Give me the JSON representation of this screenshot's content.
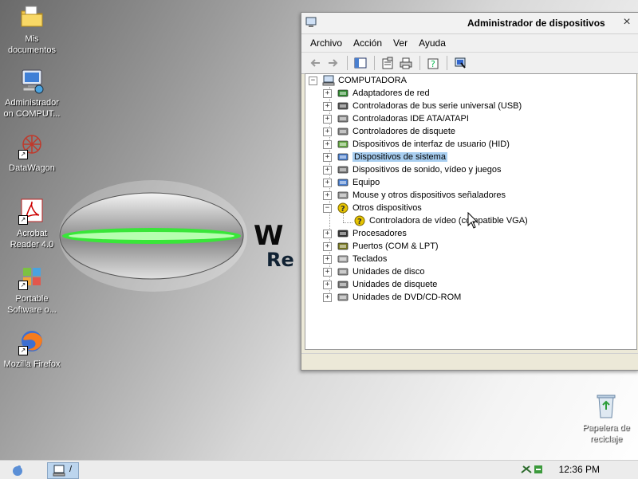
{
  "desktop": {
    "icons": [
      {
        "label_line1": "Mis",
        "label_line2": "documentos",
        "icon": "folder-documents-icon"
      },
      {
        "label_line1": "Administrador",
        "label_line2": "on COMPUT...",
        "icon": "computer-icon"
      },
      {
        "label_line1": "DataWagon",
        "label_line2": "",
        "icon": "datawagon-icon"
      },
      {
        "label_line1": "Acrobat",
        "label_line2": "Reader 4.0",
        "icon": "acrobat-reader-icon"
      },
      {
        "label_line1": "Portable",
        "label_line2": "Software o...",
        "icon": "portable-software-icon"
      },
      {
        "label_line1": "Mozilla Firefox",
        "label_line2": "",
        "icon": "firefox-icon"
      },
      {
        "label_line1": "Papelera de",
        "label_line2": "reciclaje",
        "icon": "recycle-bin-icon"
      }
    ],
    "wallpaper_letters": {
      "big": "W",
      "small": "Re"
    }
  },
  "window": {
    "title": "Administrador de dispositivos",
    "close_glyph": "×",
    "menu": [
      "Archivo",
      "Acción",
      "Ver",
      "Ayuda"
    ],
    "toolbar": [
      "back-icon",
      "forward-icon",
      "show-hide-tree-icon",
      "properties-icon",
      "print-icon",
      "help-icon",
      "scan-hardware-icon"
    ],
    "tree": {
      "root": "COMPUTADORA",
      "items": [
        {
          "label": "Adaptadores de red",
          "icon": "network-adapter-icon",
          "expander": "+"
        },
        {
          "label": "Controladoras de bus serie universal (USB)",
          "icon": "usb-icon",
          "expander": "+"
        },
        {
          "label": "Controladoras IDE ATA/ATAPI",
          "icon": "ide-controller-icon",
          "expander": "+"
        },
        {
          "label": "Controladores de disquete",
          "icon": "floppy-controller-icon",
          "expander": "+"
        },
        {
          "label": "Dispositivos de interfaz de usuario (HID)",
          "icon": "hid-icon",
          "expander": "+"
        },
        {
          "label": "Dispositivos de sistema",
          "icon": "system-devices-icon",
          "expander": "+",
          "selected": true
        },
        {
          "label": "Dispositivos de sonido, vídeo y juegos",
          "icon": "sound-icon",
          "expander": "+"
        },
        {
          "label": "Equipo",
          "icon": "computer-equipment-icon",
          "expander": "+"
        },
        {
          "label": "Mouse y otros dispositivos señaladores",
          "icon": "mouse-icon",
          "expander": "+"
        },
        {
          "label": "Otros dispositivos",
          "icon": "unknown-device-icon",
          "expander": "−"
        },
        {
          "label": "Controladora de vídeo (compatible VGA)",
          "icon": "unknown-device-warning-icon",
          "child": true
        },
        {
          "label": "Procesadores",
          "icon": "processor-icon",
          "expander": "+"
        },
        {
          "label": "Puertos (COM & LPT)",
          "icon": "ports-icon",
          "expander": "+"
        },
        {
          "label": "Teclados",
          "icon": "keyboard-icon",
          "expander": "+"
        },
        {
          "label": "Unidades de disco",
          "icon": "disk-drive-icon",
          "expander": "+"
        },
        {
          "label": "Unidades de disquete",
          "icon": "floppy-drive-icon",
          "expander": "+"
        },
        {
          "label": "Unidades de DVD/CD-ROM",
          "icon": "dvd-drive-icon",
          "expander": "+"
        }
      ]
    },
    "root_expander": "−"
  },
  "taskbar": {
    "time": "12:36 PM",
    "task_label": "/"
  },
  "colors": {
    "selection": "#a8cef0",
    "wallpaper_glow": "#39e639"
  }
}
